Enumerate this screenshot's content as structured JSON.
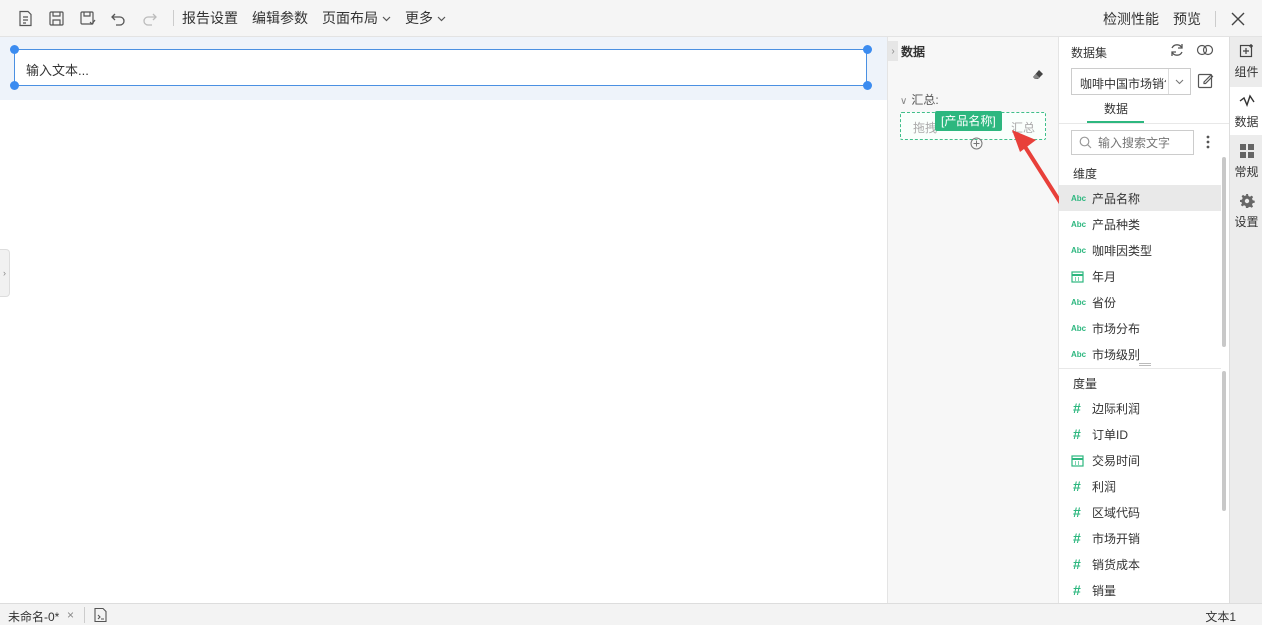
{
  "toolbar": {
    "menus": [
      "报告设置",
      "编辑参数",
      "页面布局",
      "更多"
    ],
    "right_menus": [
      "检测性能",
      "预览"
    ]
  },
  "canvas": {
    "textbox_placeholder": "输入文本..."
  },
  "data_panel": {
    "title": "数据",
    "summary_label": "汇总:",
    "drop_hint_left": "拖拽",
    "drop_hint_right": "汇总",
    "drag_chip": "[产品名称]"
  },
  "dataset": {
    "label": "数据集",
    "selected": "咖啡中国市场销售",
    "tab": "数据",
    "search_placeholder": "输入搜索文字",
    "dimension_header": "维度",
    "dimensions": [
      {
        "name": "产品名称",
        "type": "text"
      },
      {
        "name": "产品种类",
        "type": "text"
      },
      {
        "name": "咖啡因类型",
        "type": "text"
      },
      {
        "name": "年月",
        "type": "date"
      },
      {
        "name": "省份",
        "type": "text"
      },
      {
        "name": "市场分布",
        "type": "text"
      },
      {
        "name": "市场级别",
        "type": "text"
      }
    ],
    "measure_header": "度量",
    "measures": [
      {
        "name": "边际利润",
        "type": "number"
      },
      {
        "name": "订单ID",
        "type": "number"
      },
      {
        "name": "交易时间",
        "type": "date"
      },
      {
        "name": "利润",
        "type": "number"
      },
      {
        "name": "区域代码",
        "type": "number"
      },
      {
        "name": "市场开销",
        "type": "number"
      },
      {
        "name": "销货成本",
        "type": "number"
      },
      {
        "name": "销量",
        "type": "number"
      }
    ],
    "type_badge_text": "Abc",
    "type_badge_number": "#"
  },
  "rail": {
    "items": [
      "组件",
      "数据",
      "常规",
      "设置"
    ]
  },
  "statusbar": {
    "tab_name": "未命名-0*",
    "tab_close": "×",
    "component_name": "文本1"
  },
  "colors": {
    "accent": "#2db77f",
    "selection": "#3c8cf0",
    "arrow": "#e8403a"
  }
}
